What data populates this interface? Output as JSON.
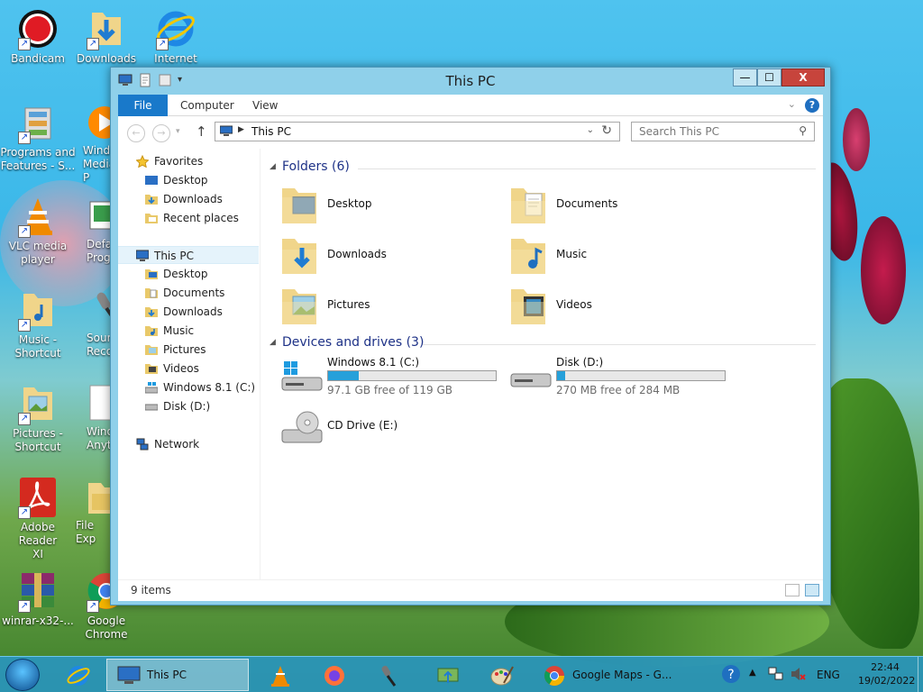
{
  "desktop": {
    "icons": [
      {
        "name": "desktop-icon-bandicam",
        "lines": [
          "Bandicam"
        ]
      },
      {
        "name": "desktop-icon-downloads",
        "lines": [
          "Downloads"
        ]
      },
      {
        "name": "desktop-icon-internet",
        "lines": [
          "Internet"
        ]
      },
      {
        "name": "desktop-icon-programs-features",
        "lines": [
          "Programs and",
          "Features - S..."
        ]
      },
      {
        "name": "desktop-icon-windows-media",
        "lines": [
          "Windo",
          "Media P"
        ]
      },
      {
        "name": "desktop-icon-vlc",
        "lines": [
          "VLC media",
          "player"
        ]
      },
      {
        "name": "desktop-icon-default-programs",
        "lines": [
          "Defa",
          "Progra"
        ]
      },
      {
        "name": "desktop-icon-music-shortcut",
        "lines": [
          "Music -",
          "Shortcut"
        ]
      },
      {
        "name": "desktop-icon-sound-recorder",
        "lines": [
          "Sour",
          "Recor"
        ]
      },
      {
        "name": "desktop-icon-pictures-shortcut",
        "lines": [
          "Pictures -",
          "Shortcut"
        ]
      },
      {
        "name": "desktop-icon-windows-anytime",
        "lines": [
          "Windo",
          "Anytii"
        ]
      },
      {
        "name": "desktop-icon-adobe-reader",
        "lines": [
          "Adobe Reader",
          "XI"
        ]
      },
      {
        "name": "desktop-icon-file-explorer",
        "lines": [
          "File Exp",
          ""
        ]
      },
      {
        "name": "desktop-icon-winrar",
        "lines": [
          "winrar-x32-...",
          ""
        ]
      },
      {
        "name": "desktop-icon-google-chrome",
        "lines": [
          "Google",
          "Chrome"
        ]
      }
    ]
  },
  "window": {
    "title": "This PC",
    "controls": {
      "minimize": "—",
      "maximize": "☐",
      "close": "X"
    },
    "ribbon": {
      "file": "File",
      "computer": "Computer",
      "view": "View",
      "help": "?"
    },
    "address": {
      "path": "This PC",
      "separator": "▶"
    },
    "search": {
      "placeholder": "Search This PC"
    },
    "nav": {
      "favorites": "Favorites",
      "favorites_items": [
        "Desktop",
        "Downloads",
        "Recent places"
      ],
      "this_pc": "This PC",
      "this_pc_items": [
        "Desktop",
        "Documents",
        "Downloads",
        "Music",
        "Pictures",
        "Videos",
        "Windows 8.1 (C:)",
        "Disk (D:)"
      ],
      "network": "Network"
    },
    "folders": {
      "header": "Folders (6)",
      "items": [
        "Desktop",
        "Documents",
        "Downloads",
        "Music",
        "Pictures",
        "Videos"
      ]
    },
    "devices": {
      "header": "Devices and drives (3)",
      "drives": [
        {
          "name": "Windows 8.1 (C:)",
          "free": "97.1 GB free of 119 GB",
          "used_fraction": 0.184
        },
        {
          "name": "Disk (D:)",
          "free": "270 MB free of 284 MB",
          "used_fraction": 0.049
        },
        {
          "name": "CD Drive (E:)"
        }
      ]
    },
    "status": {
      "count": "9 items"
    }
  },
  "taskbar": {
    "this_pc_label": "This PC",
    "chrome_label": "Google Maps - G...",
    "lang": "ENG",
    "time": "22:44",
    "date": "19/02/2022"
  },
  "colors": {
    "accent": "#1979ca",
    "drive_fill": "#26a0da",
    "group_header": "#1e3287"
  }
}
